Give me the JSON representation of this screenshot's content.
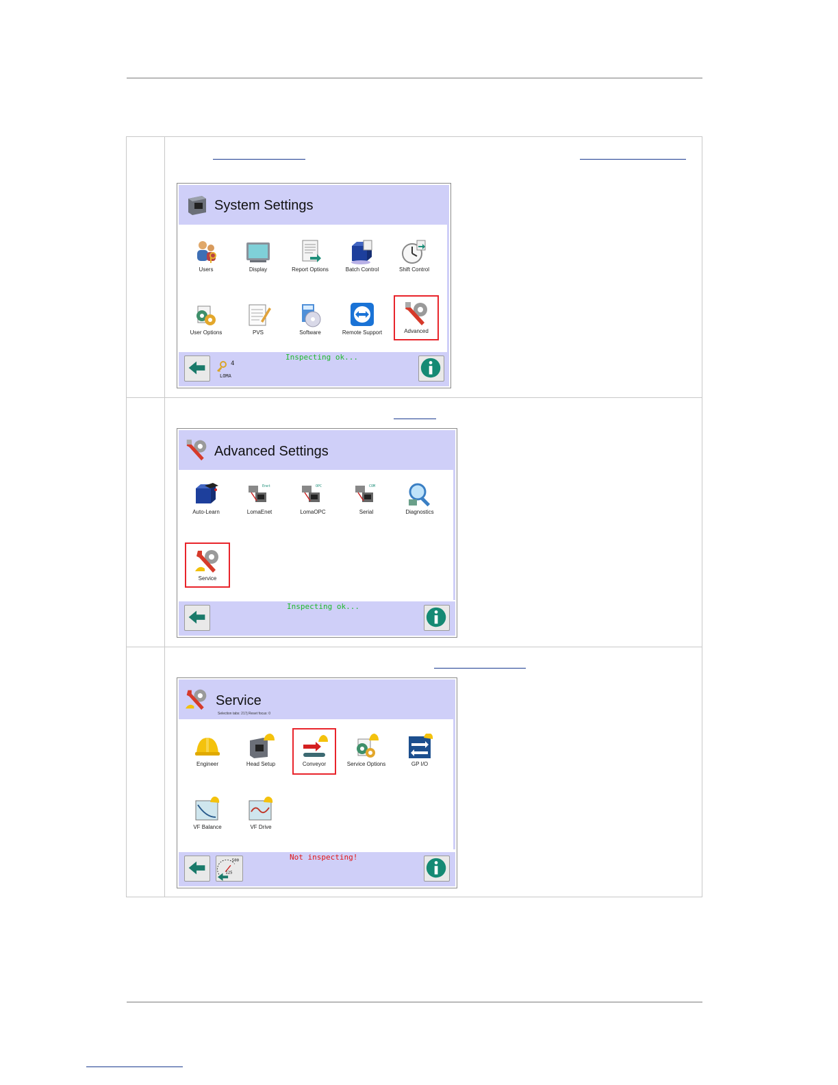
{
  "screens": {
    "system": {
      "title": "System Settings",
      "tiles": [
        {
          "label": "Users",
          "icon": "users-icon"
        },
        {
          "label": "Display",
          "icon": "display-icon"
        },
        {
          "label": "Report Options",
          "icon": "report-options-icon"
        },
        {
          "label": "Batch Control",
          "icon": "batch-control-icon"
        },
        {
          "label": "Shift Control",
          "icon": "shift-control-icon"
        },
        {
          "label": "User Options",
          "icon": "user-options-icon"
        },
        {
          "label": "PVS",
          "icon": "pvs-icon"
        },
        {
          "label": "Software",
          "icon": "software-icon"
        },
        {
          "label": "Remote Support",
          "icon": "remote-support-icon"
        },
        {
          "label": "Advanced",
          "icon": "advanced-icon"
        }
      ],
      "status": "Inspecting ok...",
      "user_level": "4",
      "user_name": "LOMA"
    },
    "advanced": {
      "title": "Advanced Settings",
      "tiles": [
        {
          "label": "Auto-Learn",
          "icon": "auto-learn-icon"
        },
        {
          "label": "LomaEnet",
          "icon": "lomaenet-icon",
          "tag": "Enet"
        },
        {
          "label": "LomaOPC",
          "icon": "lomaopc-icon",
          "tag": "OPC"
        },
        {
          "label": "Serial",
          "icon": "serial-icon",
          "tag": "COM"
        },
        {
          "label": "Diagnostics",
          "icon": "diagnostics-icon"
        },
        {
          "label": "Service",
          "icon": "service-icon"
        }
      ],
      "status": "Inspecting ok..."
    },
    "service": {
      "title": "Service",
      "subtitle": "Selection tabs: 217j Reset focus: 0",
      "tiles": [
        {
          "label": "Engineer",
          "icon": "engineer-icon"
        },
        {
          "label": "Head Setup",
          "icon": "head-setup-icon"
        },
        {
          "label": "Conveyor",
          "icon": "conveyor-icon"
        },
        {
          "label": "Service Options",
          "icon": "service-options-icon"
        },
        {
          "label": "GP I/O",
          "icon": "gp-io-icon"
        },
        {
          "label": "VF Balance",
          "icon": "vf-balance-icon"
        },
        {
          "label": "VF Drive",
          "icon": "vf-drive-icon"
        }
      ],
      "status": "Not inspecting!",
      "speed_top": "500",
      "speed_bottom": "125"
    }
  },
  "colors": {
    "header_bg": "#cfcff8",
    "highlight": "#e8232a",
    "status_ok": "#1fb82c",
    "status_bad": "#e01515"
  }
}
